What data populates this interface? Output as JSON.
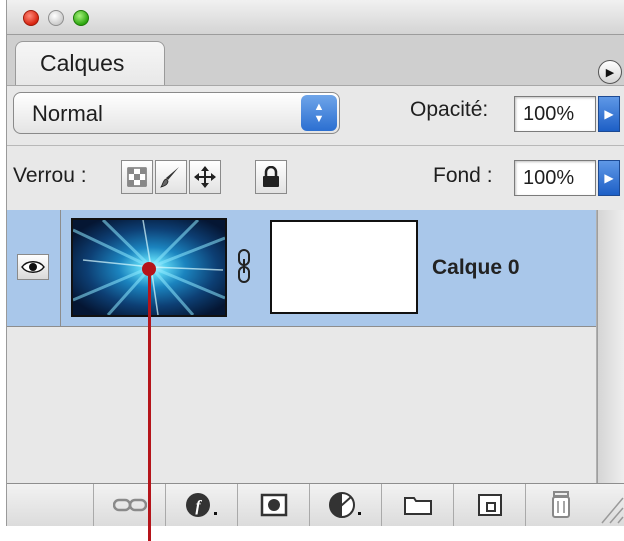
{
  "panel": {
    "tab_label": "Calques",
    "blend_mode": "Normal",
    "opacity_label": "Opacité:",
    "opacity_value": "100%",
    "lock_label": "Verrou :",
    "fill_label": "Fond :",
    "fill_value": "100%"
  },
  "layers": [
    {
      "name": "Calque 0",
      "visible": true,
      "selected": true
    }
  ],
  "lock_icons": [
    "lock-transparent-icon",
    "lock-paint-icon",
    "lock-position-icon",
    "lock-all-icon"
  ],
  "bottom_toolbar_icons": [
    "link-layers-icon",
    "layer-style-icon",
    "add-mask-icon",
    "adjustment-layer-icon",
    "new-group-icon",
    "new-layer-icon",
    "trash-icon"
  ],
  "colors": {
    "selection": "#a9c7ea",
    "accent_blue": "#2b6fd1",
    "callout_red": "#b5141a"
  }
}
